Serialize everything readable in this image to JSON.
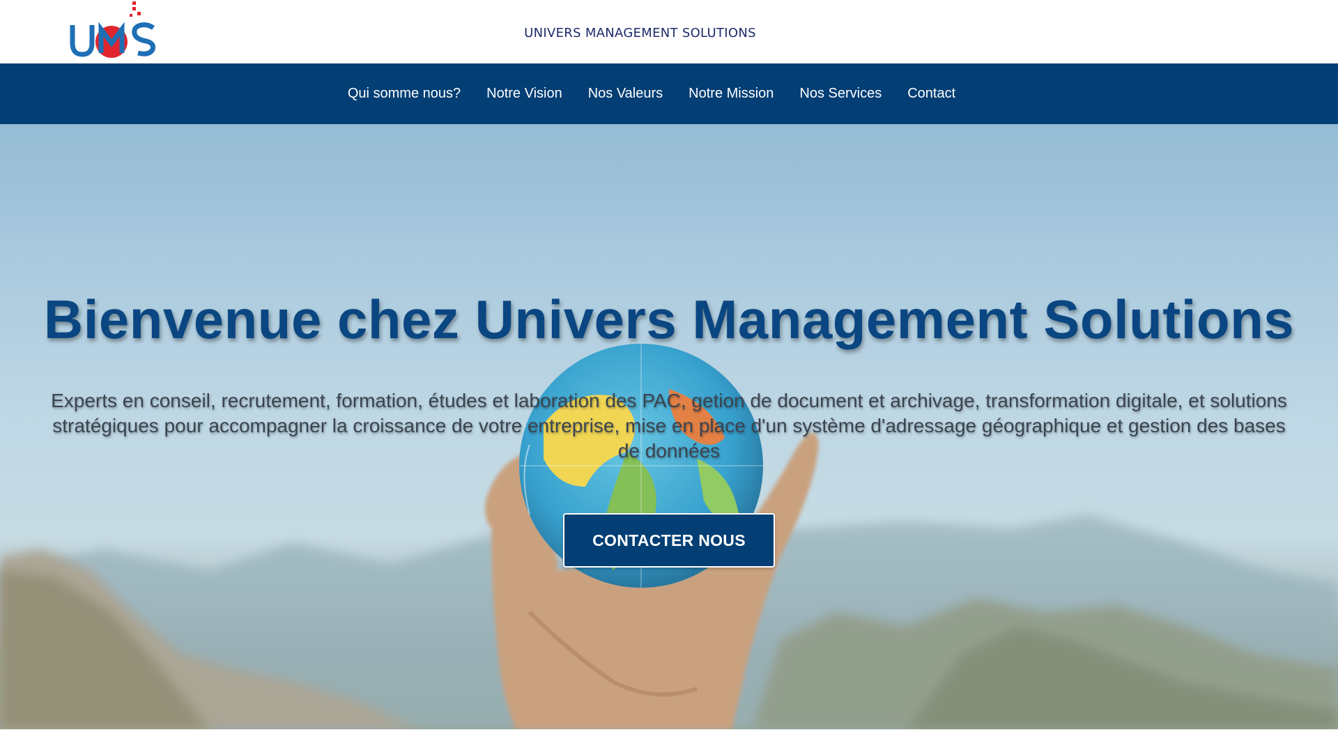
{
  "header": {
    "logo_text": "UMS",
    "site_title": "UNIVERS MANAGEMENT SOLUTIONS"
  },
  "nav": {
    "items": [
      {
        "label": "Qui somme nous?"
      },
      {
        "label": "Notre Vision"
      },
      {
        "label": "Nos Valeurs"
      },
      {
        "label": "Notre Mission"
      },
      {
        "label": "Nos Services"
      },
      {
        "label": "Contact"
      }
    ]
  },
  "hero": {
    "title": "Bienvenue chez Univers Management Solutions",
    "subtitle": "Experts en conseil, recrutement, formation, études et laboration des PAC, getion de document et archivage, transformation digitale, et solutions stratégiques pour accompagner la croissance de votre entreprise, mise en place d'un système d'adressage géographique et gestion des bases de données",
    "cta_label": "CONTACTER NOUS",
    "background_image": "hand-holding-globe-mountains"
  },
  "colors": {
    "brand_blue": "#033e74",
    "logo_blue": "#1f6fb5",
    "logo_red": "#e0252f",
    "title_blue": "#0a4681",
    "white": "#ffffff"
  }
}
